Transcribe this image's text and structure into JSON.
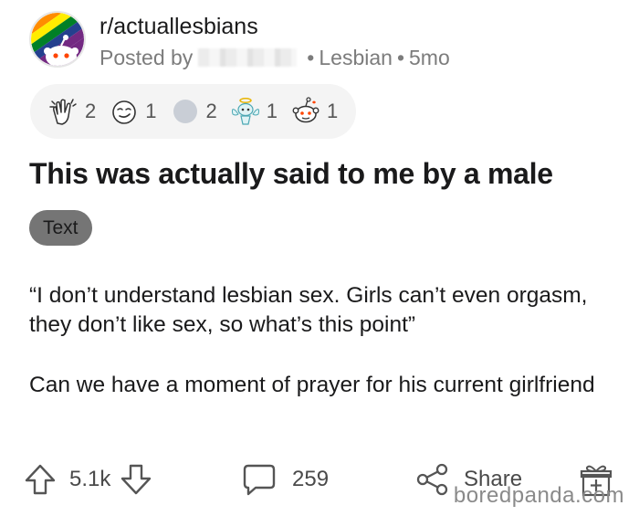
{
  "post": {
    "subreddit": "r/actuallesbians",
    "posted_by_label": "Posted by",
    "user_flair": "Lesbian",
    "age": "5mo",
    "title": "This was actually said to me by a male",
    "post_flair": "Text",
    "paragraphs": [
      "“I don’t understand lesbian sex. Girls can’t even orgasm, they don’t like sex, so what’s this point”",
      "Can we have a moment of prayer for his current girlfriend"
    ]
  },
  "awards": [
    {
      "icon": "clapping-hands-icon",
      "count": "2"
    },
    {
      "icon": "smirk-face-icon",
      "count": "1"
    },
    {
      "icon": "silver-award-icon",
      "count": "2"
    },
    {
      "icon": "angel-snoo-icon",
      "count": "1"
    },
    {
      "icon": "wholesome-snoo-icon",
      "count": "1"
    }
  ],
  "actions": {
    "score": "5.1k",
    "comments": "259",
    "share_label": "Share"
  },
  "watermark": "boredpanda.com",
  "colors": {
    "text": "#1a1a1b",
    "meta": "#7c7c7c",
    "flair_bg": "#757575",
    "awards_bg": "#f4f4f4"
  }
}
